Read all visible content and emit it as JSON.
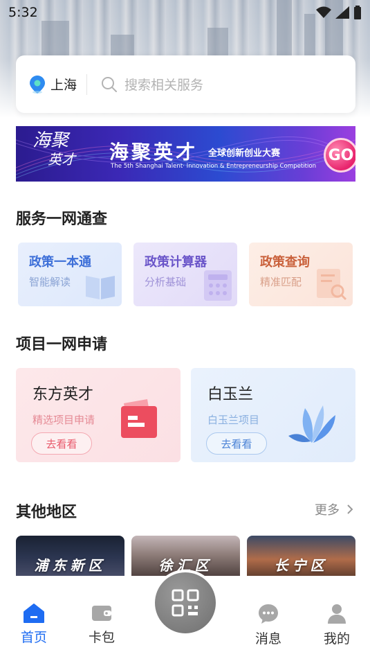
{
  "status_bar": {
    "time": "5:32"
  },
  "search": {
    "city": "上海",
    "placeholder": "搜索相关服务"
  },
  "banner": {
    "logo_line1": "海聚",
    "logo_line2": "英才",
    "title": "海聚英才",
    "subtitle": "全球创新创业大赛",
    "english": "The 5th Shanghai Talent· Innovation & Entrepreneurship Competition",
    "go_label": "GO"
  },
  "services": {
    "title": "服务一网通查",
    "items": [
      {
        "name": "政策一本通",
        "desc": "智能解读",
        "icon": "book-icon",
        "color": "#3d6fd8"
      },
      {
        "name": "政策计算器",
        "desc": "分析基础",
        "icon": "calculator-icon",
        "color": "#6a55c9"
      },
      {
        "name": "政策查询",
        "desc": "精准匹配",
        "icon": "document-search-icon",
        "color": "#c9603a"
      }
    ]
  },
  "projects": {
    "title": "项目一网申请",
    "items": [
      {
        "name": "东方英才",
        "desc": "精选项目申请",
        "button": "去看看",
        "icon": "folder-icon",
        "accent": "#e8596b"
      },
      {
        "name": "白玉兰",
        "desc": "白玉兰项目",
        "button": "去看看",
        "icon": "magnolia-icon",
        "accent": "#4a82d6"
      }
    ]
  },
  "regions": {
    "title": "其他地区",
    "more_label": "更多",
    "items": [
      {
        "name": "浦东新区"
      },
      {
        "name": "徐汇区"
      },
      {
        "name": "长宁区"
      }
    ]
  },
  "tabbar": {
    "items": [
      {
        "label": "首页",
        "icon": "home-icon",
        "active": true
      },
      {
        "label": "卡包",
        "icon": "wallet-icon",
        "active": false
      },
      {
        "label": "消息",
        "icon": "message-icon",
        "active": false
      },
      {
        "label": "我的",
        "icon": "user-icon",
        "active": false
      }
    ],
    "center_icon": "qr-scan-icon"
  }
}
